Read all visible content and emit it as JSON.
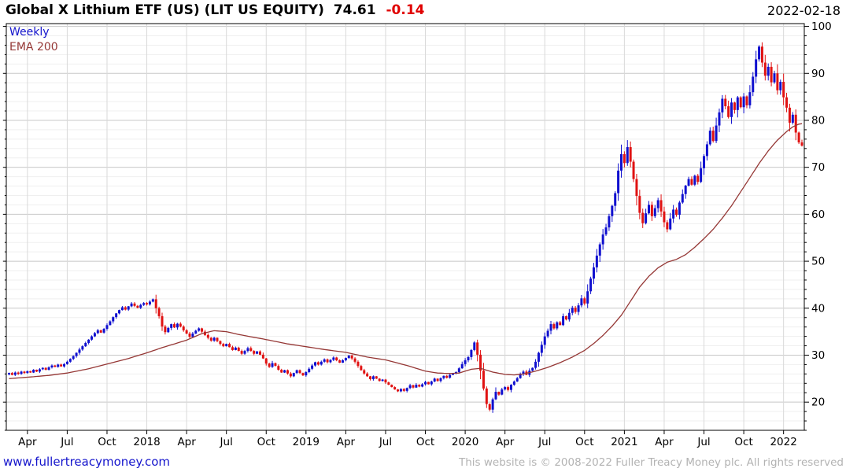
{
  "header": {
    "title": "Global X Lithium ETF (US) (LIT US EQUITY)",
    "last_price": "74.61",
    "change": "-0.14",
    "date": "2022-02-18"
  },
  "legend": {
    "timeframe": "Weekly",
    "overlay": "EMA 200"
  },
  "footer": {
    "site": "www.fullertreacymoney.com",
    "copyright": "This website is © 2008-2022 Fuller Treacy Money plc. All rights reserved"
  },
  "colors": {
    "up_candle": "#1010cf",
    "down_candle": "#e01212",
    "ema_line": "#953735",
    "change_text": "#e00000",
    "timeframe_text": "#1414cc",
    "link_text": "#1414cc",
    "copyright_text": "#b3b3b3",
    "grid_major": "#c8c8c8",
    "grid_minor": "#efefef",
    "grid_vertical": "#d9d9d9",
    "axis_line": "#000000"
  },
  "chart_data": {
    "type": "candlestick",
    "title": "Global X Lithium ETF (US) (LIT US EQUITY)",
    "subtitle_timeframe": "Weekly",
    "overlay": "EMA 200",
    "last_close": 74.61,
    "change": -0.14,
    "as_of": "2022-02-18",
    "x_unit": "week",
    "x_range": "Feb 2017 - Feb 2022",
    "ylim": [
      14.0,
      100.6
    ],
    "y_ticks": [
      20,
      30,
      40,
      50,
      60,
      70,
      80,
      90,
      100
    ],
    "y_minor_step": 2,
    "grid": true,
    "legend_position": "top-left",
    "x_ticks": [
      {
        "label": "Apr",
        "week": 6
      },
      {
        "label": "Jul",
        "week": 19
      },
      {
        "label": "Oct",
        "week": 32
      },
      {
        "label": "2018",
        "week": 45
      },
      {
        "label": "Apr",
        "week": 58
      },
      {
        "label": "Jul",
        "week": 71
      },
      {
        "label": "Oct",
        "week": 84
      },
      {
        "label": "2019",
        "week": 97
      },
      {
        "label": "Apr",
        "week": 110
      },
      {
        "label": "Jul",
        "week": 123
      },
      {
        "label": "Oct",
        "week": 136
      },
      {
        "label": "2020",
        "week": 149
      },
      {
        "label": "Apr",
        "week": 162
      },
      {
        "label": "Jul",
        "week": 175
      },
      {
        "label": "Oct",
        "week": 188
      },
      {
        "label": "2021",
        "week": 201
      },
      {
        "label": "Apr",
        "week": 214
      },
      {
        "label": "Jul",
        "week": 227
      },
      {
        "label": "Oct",
        "week": 240
      },
      {
        "label": "2022",
        "week": 253
      }
    ],
    "series": [
      {
        "name": "LIT US weekly closes (estimated from chart)",
        "kind": "candle",
        "closes": [
          26.2,
          25.8,
          26.3,
          26.0,
          26.5,
          26.2,
          26.6,
          26.3,
          26.9,
          26.5,
          27.0,
          27.3,
          26.9,
          27.4,
          27.8,
          27.5,
          28.0,
          27.6,
          28.1,
          28.6,
          29.2,
          29.8,
          30.5,
          31.2,
          31.9,
          32.6,
          33.3,
          34.0,
          34.7,
          35.3,
          34.8,
          35.6,
          36.4,
          37.2,
          38.1,
          38.9,
          39.6,
          40.2,
          39.7,
          40.4,
          41.0,
          40.5,
          40.1,
          40.7,
          41.1,
          40.8,
          41.4,
          41.9,
          40.0,
          38.3,
          36.1,
          34.9,
          35.8,
          36.6,
          35.9,
          36.7,
          36.1,
          35.3,
          34.6,
          33.9,
          34.6,
          35.2,
          35.7,
          35.0,
          34.3,
          33.7,
          33.1,
          33.7,
          33.0,
          32.4,
          31.9,
          32.4,
          31.7,
          31.1,
          31.6,
          30.9,
          30.3,
          30.9,
          31.5,
          30.9,
          30.3,
          30.8,
          30.1,
          29.3,
          28.2,
          27.5,
          28.3,
          27.7,
          26.9,
          26.3,
          26.8,
          26.1,
          25.5,
          26.2,
          26.8,
          26.2,
          25.7,
          26.4,
          27.1,
          27.8,
          28.5,
          28.0,
          28.6,
          29.1,
          28.5,
          29.0,
          29.5,
          28.9,
          28.4,
          28.9,
          29.4,
          29.9,
          29.3,
          28.6,
          27.7,
          26.8,
          26.1,
          25.5,
          24.9,
          25.5,
          25.0,
          24.5,
          24.8,
          24.2,
          23.7,
          23.2,
          22.7,
          22.3,
          22.8,
          22.4,
          23.0,
          23.6,
          23.1,
          23.7,
          23.3,
          23.8,
          24.3,
          23.8,
          24.4,
          25.0,
          24.5,
          25.1,
          25.6,
          25.2,
          25.8,
          26.1,
          26.4,
          27.2,
          28.1,
          28.9,
          29.6,
          31.1,
          32.7,
          30.1,
          26.7,
          22.9,
          19.6,
          18.4,
          20.6,
          22.2,
          21.6,
          22.7,
          23.2,
          22.6,
          23.7,
          24.4,
          25.1,
          25.9,
          26.5,
          25.8,
          26.7,
          27.3,
          28.6,
          30.5,
          32.2,
          34.0,
          35.2,
          36.6,
          35.7,
          37.0,
          36.4,
          38.3,
          37.6,
          39.0,
          40.1,
          39.2,
          40.6,
          42.1,
          41.0,
          43.6,
          46.3,
          48.7,
          51.2,
          53.6,
          55.7,
          57.2,
          59.6,
          61.8,
          64.5,
          69.3,
          72.8,
          70.9,
          74.3,
          71.2,
          67.5,
          63.9,
          60.3,
          58.1,
          60.2,
          62.0,
          59.6,
          61.3,
          63.0,
          60.6,
          58.3,
          56.8,
          59.1,
          61.0,
          59.9,
          62.5,
          64.3,
          66.1,
          67.5,
          66.3,
          68.2,
          66.9,
          69.8,
          72.4,
          74.9,
          77.8,
          75.6,
          78.9,
          81.7,
          84.6,
          83.0,
          80.7,
          83.8,
          82.2,
          84.9,
          82.8,
          85.1,
          83.2,
          86.0,
          89.3,
          93.0,
          95.7,
          92.3,
          89.5,
          91.4,
          88.1,
          90.0,
          86.4,
          88.2,
          84.9,
          82.7,
          79.5,
          81.2,
          77.4,
          75.3,
          74.61
        ]
      },
      {
        "name": "EMA 200",
        "kind": "line",
        "anchors": [
          [
            0,
            25.0
          ],
          [
            6,
            25.3
          ],
          [
            13,
            25.7
          ],
          [
            19,
            26.2
          ],
          [
            26,
            27.1
          ],
          [
            32,
            28.1
          ],
          [
            39,
            29.3
          ],
          [
            45,
            30.5
          ],
          [
            50,
            31.6
          ],
          [
            54,
            32.4
          ],
          [
            58,
            33.2
          ],
          [
            63,
            34.6
          ],
          [
            67,
            35.2
          ],
          [
            71,
            35.0
          ],
          [
            75,
            34.4
          ],
          [
            80,
            33.8
          ],
          [
            85,
            33.2
          ],
          [
            91,
            32.4
          ],
          [
            97,
            31.8
          ],
          [
            103,
            31.2
          ],
          [
            110,
            30.6
          ],
          [
            117,
            29.6
          ],
          [
            123,
            29.0
          ],
          [
            130,
            27.8
          ],
          [
            136,
            26.6
          ],
          [
            140,
            26.2
          ],
          [
            144,
            26.1
          ],
          [
            147,
            26.2
          ],
          [
            151,
            27.0
          ],
          [
            154,
            27.2
          ],
          [
            158,
            26.4
          ],
          [
            162,
            25.9
          ],
          [
            165,
            25.8
          ],
          [
            168,
            26.0
          ],
          [
            172,
            26.6
          ],
          [
            176,
            27.4
          ],
          [
            180,
            28.4
          ],
          [
            184,
            29.6
          ],
          [
            188,
            31.0
          ],
          [
            191,
            32.5
          ],
          [
            194,
            34.2
          ],
          [
            197,
            36.2
          ],
          [
            200,
            38.5
          ],
          [
            203,
            41.5
          ],
          [
            206,
            44.5
          ],
          [
            209,
            46.8
          ],
          [
            212,
            48.6
          ],
          [
            215,
            49.8
          ],
          [
            218,
            50.4
          ],
          [
            221,
            51.4
          ],
          [
            224,
            53.0
          ],
          [
            227,
            54.8
          ],
          [
            230,
            56.8
          ],
          [
            233,
            59.2
          ],
          [
            236,
            61.8
          ],
          [
            239,
            64.8
          ],
          [
            242,
            67.8
          ],
          [
            245,
            70.8
          ],
          [
            248,
            73.5
          ],
          [
            251,
            75.8
          ],
          [
            254,
            77.6
          ],
          [
            256,
            78.6
          ],
          [
            258,
            79.2
          ],
          [
            259,
            79.3
          ]
        ]
      }
    ]
  }
}
